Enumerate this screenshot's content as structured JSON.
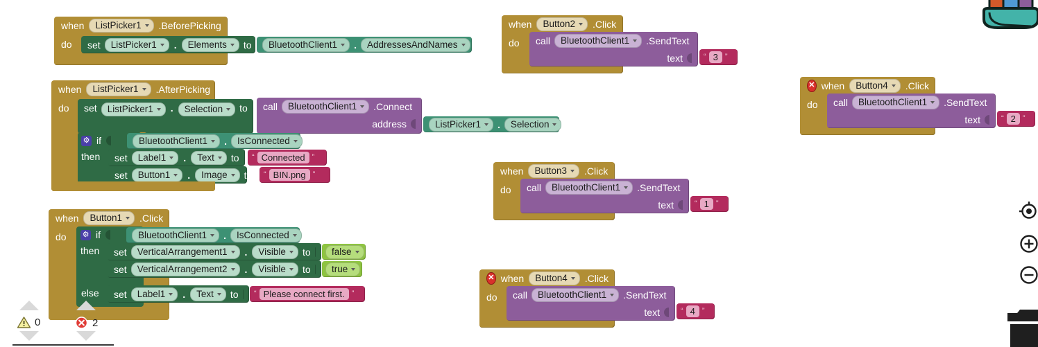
{
  "app": {
    "name": "MIT App Inventor Blocks Editor",
    "canvas_background": "#ffffff"
  },
  "colors": {
    "event_block": "#b18e35",
    "setter_block": "#2f6b45",
    "getter_block": "#3d9174",
    "call_block": "#8d5d9b",
    "text_block": "#b32b5d",
    "logic_block": "#8ec441",
    "mutator_icon": "#4a3fa8",
    "error_badge": "#d9312b",
    "warning_badge": "#f2e96b"
  },
  "blocks": [
    {
      "id": "listpicker1-beforepicking",
      "kind": "event",
      "when_label": "when",
      "component": "ListPicker1",
      "event": ".BeforePicking",
      "do_label": "do",
      "has_error": false,
      "statements": [
        {
          "kind": "setter",
          "set_label": "set",
          "component": "ListPicker1",
          "property": "Elements",
          "to_label": "to",
          "value": {
            "kind": "getter",
            "component": "BluetoothClient1",
            "property": "AddressesAndNames"
          }
        }
      ]
    },
    {
      "id": "listpicker1-afterpicking",
      "kind": "event",
      "when_label": "when",
      "component": "ListPicker1",
      "event": ".AfterPicking",
      "do_label": "do",
      "has_error": false,
      "statements": [
        {
          "kind": "setter",
          "set_label": "set",
          "component": "ListPicker1",
          "property": "Selection",
          "to_label": "to",
          "value": {
            "kind": "call",
            "call_label": "call",
            "component": "BluetoothClient1",
            "method": ".Connect",
            "arg_label": "address",
            "arg_value": {
              "kind": "getter",
              "component": "ListPicker1",
              "property": "Selection"
            }
          }
        },
        {
          "kind": "if",
          "if_label": "if",
          "then_label": "then",
          "condition": {
            "kind": "getter",
            "component": "BluetoothClient1",
            "property": "IsConnected"
          },
          "then_statements": [
            {
              "kind": "setter",
              "set_label": "set",
              "component": "Label1",
              "property": "Text",
              "to_label": "to",
              "value": {
                "kind": "text",
                "text": "Connected"
              }
            },
            {
              "kind": "setter",
              "set_label": "set",
              "component": "Button1",
              "property": "Image",
              "to_label": "to",
              "value": {
                "kind": "text",
                "text": "BIN.png"
              }
            }
          ]
        }
      ]
    },
    {
      "id": "button1-click",
      "kind": "event",
      "when_label": "when",
      "component": "Button1",
      "event": ".Click",
      "do_label": "do",
      "has_error": false,
      "statements": [
        {
          "kind": "if-else",
          "if_label": "if",
          "then_label": "then",
          "else_label": "else",
          "condition": {
            "kind": "getter",
            "component": "BluetoothClient1",
            "property": "IsConnected"
          },
          "then_statements": [
            {
              "kind": "setter",
              "set_label": "set",
              "component": "VerticalArrangement1",
              "property": "Visible",
              "to_label": "to",
              "value": {
                "kind": "logic",
                "text": "false"
              }
            },
            {
              "kind": "setter",
              "set_label": "set",
              "component": "VerticalArrangement2",
              "property": "Visible",
              "to_label": "to",
              "value": {
                "kind": "logic",
                "text": "true"
              }
            }
          ],
          "else_statements": [
            {
              "kind": "setter",
              "set_label": "set",
              "component": "Label1",
              "property": "Text",
              "to_label": "to",
              "value": {
                "kind": "text",
                "text": "Please connect first."
              }
            }
          ]
        }
      ]
    },
    {
      "id": "button2-click",
      "kind": "event",
      "when_label": "when",
      "component": "Button2",
      "event": ".Click",
      "do_label": "do",
      "has_error": false,
      "statements": [
        {
          "kind": "call",
          "call_label": "call",
          "component": "BluetoothClient1",
          "method": ".SendText",
          "arg_label": "text",
          "arg_value": {
            "kind": "text",
            "text": "3"
          }
        }
      ]
    },
    {
      "id": "button3-click",
      "kind": "event",
      "when_label": "when",
      "component": "Button3",
      "event": ".Click",
      "do_label": "do",
      "has_error": false,
      "statements": [
        {
          "kind": "call",
          "call_label": "call",
          "component": "BluetoothClient1",
          "method": ".SendText",
          "arg_label": "text",
          "arg_value": {
            "kind": "text",
            "text": "1"
          }
        }
      ]
    },
    {
      "id": "button4-click-a",
      "kind": "event",
      "when_label": "when",
      "component": "Button4",
      "event": ".Click",
      "do_label": "do",
      "has_error": true,
      "statements": [
        {
          "kind": "call",
          "call_label": "call",
          "component": "BluetoothClient1",
          "method": ".SendText",
          "arg_label": "text",
          "arg_value": {
            "kind": "text",
            "text": "4"
          }
        }
      ]
    },
    {
      "id": "button4-click-b",
      "kind": "event",
      "when_label": "when",
      "component": "Button4",
      "event": ".Click",
      "do_label": "do",
      "has_error": true,
      "statements": [
        {
          "kind": "call",
          "call_label": "call",
          "component": "BluetoothClient1",
          "method": ".SendText",
          "arg_label": "text",
          "arg_value": {
            "kind": "text",
            "text": "2"
          }
        }
      ]
    }
  ],
  "b1": {
    "when": "when",
    "component": "ListPicker1",
    "event": ".BeforePicking",
    "do": "do",
    "s1_set": "set",
    "s1_component": "ListPicker1",
    "s1_property": "Elements",
    "s1_to": "to",
    "s1_val_component": "BluetoothClient1",
    "s1_val_property": "AddressesAndNames"
  },
  "b2": {
    "when": "when",
    "component": "ListPicker1",
    "event": ".AfterPicking",
    "do": "do",
    "s1_set": "set",
    "s1_component": "ListPicker1",
    "s1_property": "Selection",
    "s1_to": "to",
    "call": "call",
    "call_component": "BluetoothClient1",
    "call_method": ".Connect",
    "address_label": "address",
    "address_component": "ListPicker1",
    "address_property": "Selection",
    "if": "if",
    "then": "then",
    "cond_component": "BluetoothClient1",
    "cond_property": "IsConnected",
    "t1_set": "set",
    "t1_component": "Label1",
    "t1_property": "Text",
    "t1_to": "to",
    "t1_text": "Connected",
    "t2_set": "set",
    "t2_component": "Button1",
    "t2_property": "Image",
    "t2_to": "to",
    "t2_text": "BIN.png"
  },
  "b3": {
    "when": "when",
    "component": "Button1",
    "event": ".Click",
    "do": "do",
    "if": "if",
    "then": "then",
    "else": "else",
    "cond_component": "BluetoothClient1",
    "cond_property": "IsConnected",
    "t1_set": "set",
    "t1_component": "VerticalArrangement1",
    "t1_property": "Visible",
    "t1_to": "to",
    "t1_value": "false",
    "t2_set": "set",
    "t2_component": "VerticalArrangement2",
    "t2_property": "Visible",
    "t2_to": "to",
    "t2_value": "true",
    "e1_set": "set",
    "e1_component": "Label1",
    "e1_property": "Text",
    "e1_to": "to",
    "e1_text": "Please connect first."
  },
  "b4": {
    "when": "when",
    "component": "Button2",
    "event": ".Click",
    "do": "do",
    "call": "call",
    "call_component": "BluetoothClient1",
    "call_method": ".SendText",
    "text_label": "text",
    "text_value": "3"
  },
  "b5": {
    "when": "when",
    "component": "Button3",
    "event": ".Click",
    "do": "do",
    "call": "call",
    "call_component": "BluetoothClient1",
    "call_method": ".SendText",
    "text_label": "text",
    "text_value": "1"
  },
  "b6": {
    "when": "when",
    "component": "Button4",
    "event": ".Click",
    "do": "do",
    "call": "call",
    "call_component": "BluetoothClient1",
    "call_method": ".SendText",
    "text_label": "text",
    "text_value": "4"
  },
  "b7": {
    "when": "when",
    "component": "Button4",
    "event": ".Click",
    "do": "do",
    "call": "call",
    "call_component": "BluetoothClient1",
    "call_method": ".SendText",
    "text_label": "text",
    "text_value": "2"
  },
  "status_bar": {
    "warning_count": "0",
    "error_count": "2",
    "warning_icon": "warning-triangle-icon",
    "error_icon": "error-circle-icon",
    "nav_up_icon": "triangle-up-icon",
    "nav_down_icon": "triangle-down-icon"
  },
  "workspace_controls": {
    "backpack_icon": "backpack-icon",
    "center_icon": "center-workspace-icon",
    "zoom_in_icon": "zoom-in-icon",
    "zoom_out_icon": "zoom-out-icon",
    "trash_icon": "trash-can-icon"
  }
}
